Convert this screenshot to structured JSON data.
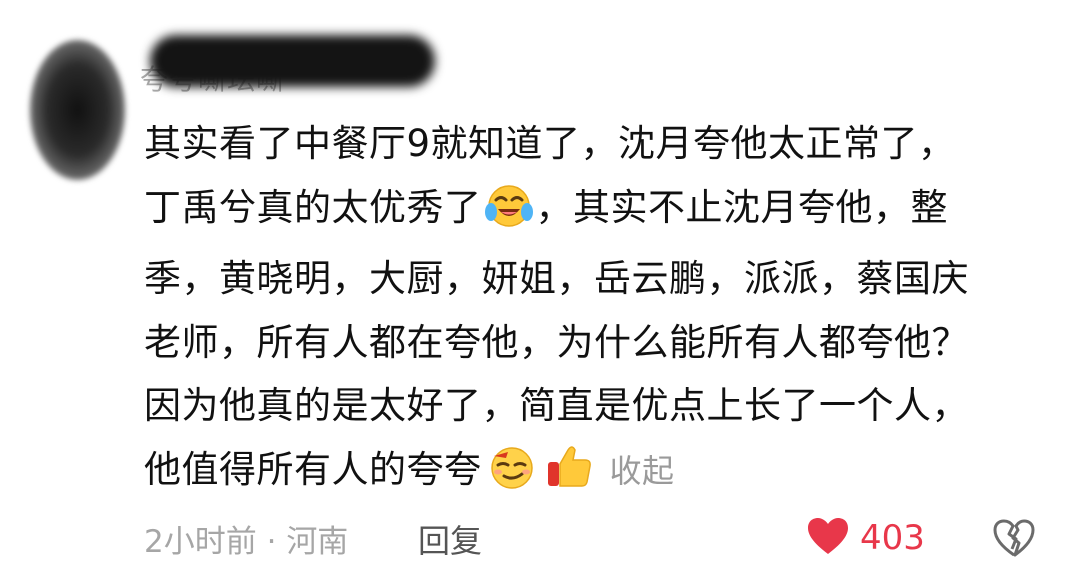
{
  "comment": {
    "username": "夸夸嘶珐嘶",
    "lines": [
      "其实看了中餐厅9就知道了，沈月夸他太正常了，",
      "丁禹兮真的太优秀了",
      "，其实不止沈月夸他，整",
      "季，黄晓明，大厨，妍姐，岳云鹏，派派，蔡国庆",
      "老师，所有人都在夸他，为什么能所有人都夸他？",
      "因为他真的是太好了，简直是优点上长了一个人，",
      "他值得所有人的夸夸"
    ],
    "collapse_label": "收起",
    "time": "2小时前",
    "separator": "·",
    "location": "河南",
    "reply_label": "回复",
    "like_count": "403",
    "icons": {
      "laugh_cry": "laughing-crying-emoji-icon",
      "smirk": "smirk-emoji-icon",
      "thumb": "thumbs-up-icon",
      "heart": "heart-icon",
      "broken_heart": "broken-heart-icon"
    },
    "colors": {
      "like": "#e8374a",
      "muted": "#a6a6a6",
      "text": "#111111"
    }
  }
}
